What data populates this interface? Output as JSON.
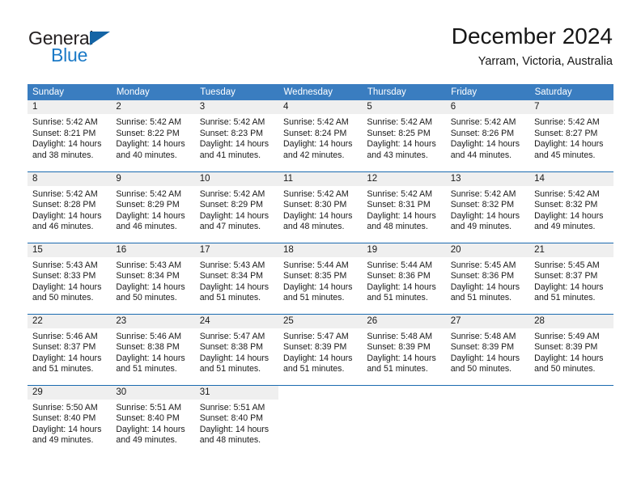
{
  "brand": {
    "name_top": "General",
    "name_bottom": "Blue",
    "triangle_color": "#1464a5",
    "text_color": "#1b7ac7"
  },
  "header": {
    "title": "December 2024",
    "subtitle": "Yarram, Victoria, Australia"
  },
  "theme": {
    "header_blue": "#3a7dc0",
    "rule_blue": "#1b6bb0",
    "daynum_band": "#efefef"
  },
  "weekdays": [
    "Sunday",
    "Monday",
    "Tuesday",
    "Wednesday",
    "Thursday",
    "Friday",
    "Saturday"
  ],
  "weeks": [
    [
      {
        "day": "1",
        "sunrise": "Sunrise: 5:42 AM",
        "sunset": "Sunset: 8:21 PM",
        "daylight": "Daylight: 14 hours and 38 minutes."
      },
      {
        "day": "2",
        "sunrise": "Sunrise: 5:42 AM",
        "sunset": "Sunset: 8:22 PM",
        "daylight": "Daylight: 14 hours and 40 minutes."
      },
      {
        "day": "3",
        "sunrise": "Sunrise: 5:42 AM",
        "sunset": "Sunset: 8:23 PM",
        "daylight": "Daylight: 14 hours and 41 minutes."
      },
      {
        "day": "4",
        "sunrise": "Sunrise: 5:42 AM",
        "sunset": "Sunset: 8:24 PM",
        "daylight": "Daylight: 14 hours and 42 minutes."
      },
      {
        "day": "5",
        "sunrise": "Sunrise: 5:42 AM",
        "sunset": "Sunset: 8:25 PM",
        "daylight": "Daylight: 14 hours and 43 minutes."
      },
      {
        "day": "6",
        "sunrise": "Sunrise: 5:42 AM",
        "sunset": "Sunset: 8:26 PM",
        "daylight": "Daylight: 14 hours and 44 minutes."
      },
      {
        "day": "7",
        "sunrise": "Sunrise: 5:42 AM",
        "sunset": "Sunset: 8:27 PM",
        "daylight": "Daylight: 14 hours and 45 minutes."
      }
    ],
    [
      {
        "day": "8",
        "sunrise": "Sunrise: 5:42 AM",
        "sunset": "Sunset: 8:28 PM",
        "daylight": "Daylight: 14 hours and 46 minutes."
      },
      {
        "day": "9",
        "sunrise": "Sunrise: 5:42 AM",
        "sunset": "Sunset: 8:29 PM",
        "daylight": "Daylight: 14 hours and 46 minutes."
      },
      {
        "day": "10",
        "sunrise": "Sunrise: 5:42 AM",
        "sunset": "Sunset: 8:29 PM",
        "daylight": "Daylight: 14 hours and 47 minutes."
      },
      {
        "day": "11",
        "sunrise": "Sunrise: 5:42 AM",
        "sunset": "Sunset: 8:30 PM",
        "daylight": "Daylight: 14 hours and 48 minutes."
      },
      {
        "day": "12",
        "sunrise": "Sunrise: 5:42 AM",
        "sunset": "Sunset: 8:31 PM",
        "daylight": "Daylight: 14 hours and 48 minutes."
      },
      {
        "day": "13",
        "sunrise": "Sunrise: 5:42 AM",
        "sunset": "Sunset: 8:32 PM",
        "daylight": "Daylight: 14 hours and 49 minutes."
      },
      {
        "day": "14",
        "sunrise": "Sunrise: 5:42 AM",
        "sunset": "Sunset: 8:32 PM",
        "daylight": "Daylight: 14 hours and 49 minutes."
      }
    ],
    [
      {
        "day": "15",
        "sunrise": "Sunrise: 5:43 AM",
        "sunset": "Sunset: 8:33 PM",
        "daylight": "Daylight: 14 hours and 50 minutes."
      },
      {
        "day": "16",
        "sunrise": "Sunrise: 5:43 AM",
        "sunset": "Sunset: 8:34 PM",
        "daylight": "Daylight: 14 hours and 50 minutes."
      },
      {
        "day": "17",
        "sunrise": "Sunrise: 5:43 AM",
        "sunset": "Sunset: 8:34 PM",
        "daylight": "Daylight: 14 hours and 51 minutes."
      },
      {
        "day": "18",
        "sunrise": "Sunrise: 5:44 AM",
        "sunset": "Sunset: 8:35 PM",
        "daylight": "Daylight: 14 hours and 51 minutes."
      },
      {
        "day": "19",
        "sunrise": "Sunrise: 5:44 AM",
        "sunset": "Sunset: 8:36 PM",
        "daylight": "Daylight: 14 hours and 51 minutes."
      },
      {
        "day": "20",
        "sunrise": "Sunrise: 5:45 AM",
        "sunset": "Sunset: 8:36 PM",
        "daylight": "Daylight: 14 hours and 51 minutes."
      },
      {
        "day": "21",
        "sunrise": "Sunrise: 5:45 AM",
        "sunset": "Sunset: 8:37 PM",
        "daylight": "Daylight: 14 hours and 51 minutes."
      }
    ],
    [
      {
        "day": "22",
        "sunrise": "Sunrise: 5:46 AM",
        "sunset": "Sunset: 8:37 PM",
        "daylight": "Daylight: 14 hours and 51 minutes."
      },
      {
        "day": "23",
        "sunrise": "Sunrise: 5:46 AM",
        "sunset": "Sunset: 8:38 PM",
        "daylight": "Daylight: 14 hours and 51 minutes."
      },
      {
        "day": "24",
        "sunrise": "Sunrise: 5:47 AM",
        "sunset": "Sunset: 8:38 PM",
        "daylight": "Daylight: 14 hours and 51 minutes."
      },
      {
        "day": "25",
        "sunrise": "Sunrise: 5:47 AM",
        "sunset": "Sunset: 8:39 PM",
        "daylight": "Daylight: 14 hours and 51 minutes."
      },
      {
        "day": "26",
        "sunrise": "Sunrise: 5:48 AM",
        "sunset": "Sunset: 8:39 PM",
        "daylight": "Daylight: 14 hours and 51 minutes."
      },
      {
        "day": "27",
        "sunrise": "Sunrise: 5:48 AM",
        "sunset": "Sunset: 8:39 PM",
        "daylight": "Daylight: 14 hours and 50 minutes."
      },
      {
        "day": "28",
        "sunrise": "Sunrise: 5:49 AM",
        "sunset": "Sunset: 8:39 PM",
        "daylight": "Daylight: 14 hours and 50 minutes."
      }
    ],
    [
      {
        "day": "29",
        "sunrise": "Sunrise: 5:50 AM",
        "sunset": "Sunset: 8:40 PM",
        "daylight": "Daylight: 14 hours and 49 minutes."
      },
      {
        "day": "30",
        "sunrise": "Sunrise: 5:51 AM",
        "sunset": "Sunset: 8:40 PM",
        "daylight": "Daylight: 14 hours and 49 minutes."
      },
      {
        "day": "31",
        "sunrise": "Sunrise: 5:51 AM",
        "sunset": "Sunset: 8:40 PM",
        "daylight": "Daylight: 14 hours and 48 minutes."
      },
      {
        "day": "",
        "sunrise": "",
        "sunset": "",
        "daylight": ""
      },
      {
        "day": "",
        "sunrise": "",
        "sunset": "",
        "daylight": ""
      },
      {
        "day": "",
        "sunrise": "",
        "sunset": "",
        "daylight": ""
      },
      {
        "day": "",
        "sunrise": "",
        "sunset": "",
        "daylight": ""
      }
    ]
  ]
}
